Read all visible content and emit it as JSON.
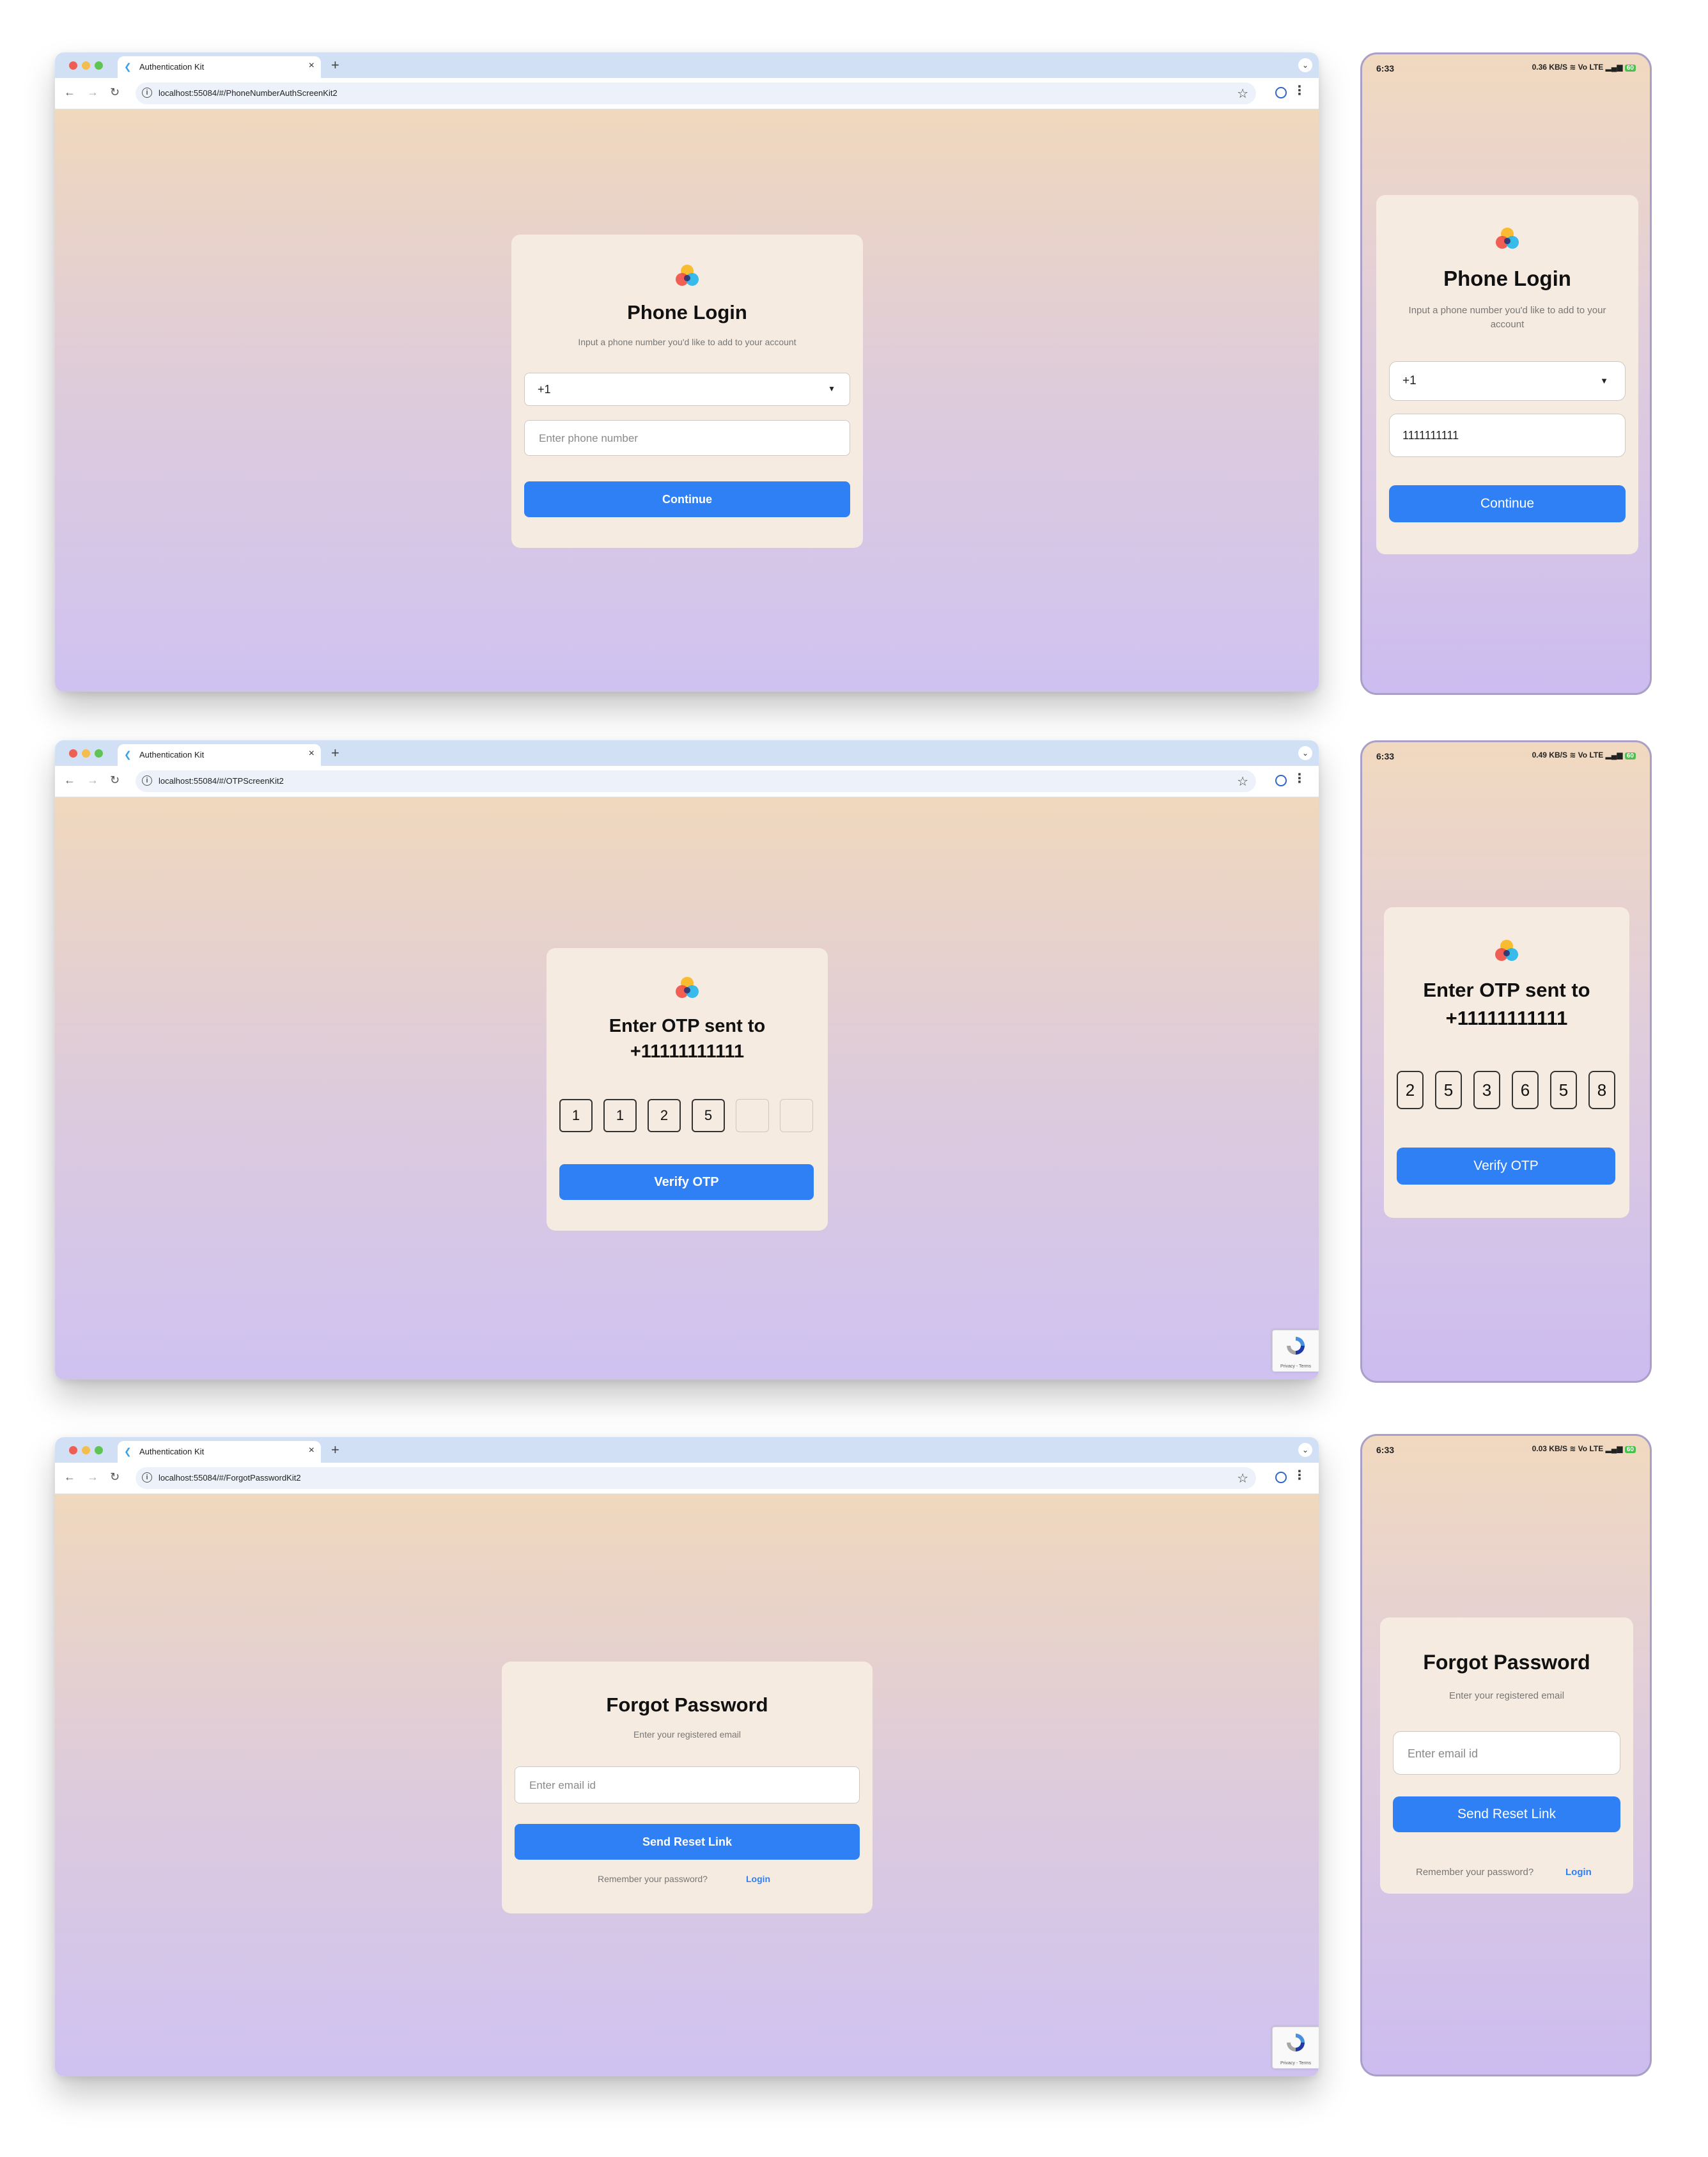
{
  "browser": {
    "tab_title": "Authentication Kit",
    "tab_close": "×",
    "new_tab": "+",
    "tab_menu": "⌄"
  },
  "screens": [
    {
      "url": "localhost:55084/#/PhoneNumberAuthScreenKit2",
      "title": "Phone Login",
      "subtitle": "Input a phone number you'd like to add to your account",
      "country_code": "+1",
      "phone_placeholder": "Enter phone number",
      "button": "Continue"
    },
    {
      "url": "localhost:55084/#/OTPScreenKit2",
      "title_line1": "Enter OTP sent to",
      "title_line2": "+11111111111",
      "otp_digits": [
        "1",
        "1",
        "2",
        "5",
        "",
        ""
      ],
      "button": "Verify OTP",
      "recaptcha_text": "Privacy - Terms"
    },
    {
      "url": "localhost:55084/#/ForgotPasswordKit2",
      "title": "Forgot Password",
      "subtitle": "Enter your registered email",
      "email_placeholder": "Enter email id",
      "button": "Send Reset Link",
      "remember_text": "Remember your password?",
      "login_link": "Login",
      "recaptcha_text": "Privacy - Terms"
    }
  ],
  "phones": [
    {
      "time": "6:33",
      "status": "0.36 KB/S  ≋  Vo LTE  ▂▄▆",
      "battery": "60",
      "title": "Phone Login",
      "subtitle_line1": "Input a phone number you'd like to add to your",
      "subtitle_line2": "account",
      "country_code": "+1",
      "phone_value": "1111111111",
      "button": "Continue"
    },
    {
      "time": "6:33",
      "status": "0.49 KB/S  ≋  Vo LTE  ▂▄▆",
      "battery": "60",
      "title_line1": "Enter OTP sent to",
      "title_line2": "+11111111111",
      "otp_digits": [
        "2",
        "5",
        "3",
        "6",
        "5",
        "8"
      ],
      "button": "Verify OTP"
    },
    {
      "time": "6:33",
      "status": "0.03 KB/S  ≋  Vo LTE  ▂▄▆",
      "battery": "60",
      "title": "Forgot Password",
      "subtitle": "Enter your registered email",
      "email_placeholder": "Enter email id",
      "button": "Send Reset Link",
      "remember_text": "Remember your password?",
      "login_link": "Login"
    }
  ]
}
